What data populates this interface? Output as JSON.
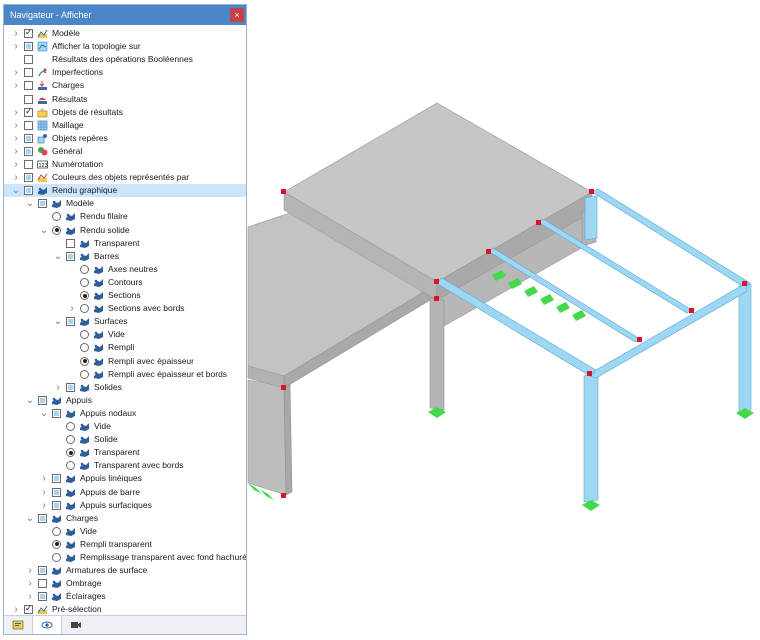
{
  "panel": {
    "title": "Navigateur - Afficher",
    "close_label": "×"
  },
  "tree": [
    {
      "label": "Modèle",
      "level": 0,
      "expander": "collapsed",
      "control": "checkbox",
      "state": "checked",
      "icon": "model-icon"
    },
    {
      "label": "Afficher la topologie sur",
      "level": 0,
      "expander": "collapsed",
      "control": "checkbox",
      "state": "partial",
      "icon": "topology-icon"
    },
    {
      "label": "Résultats des opérations Booléennes",
      "level": 0,
      "expander": "none",
      "control": "checkbox",
      "state": "unchecked",
      "icon": "none"
    },
    {
      "label": "Imperfections",
      "level": 0,
      "expander": "collapsed",
      "control": "checkbox",
      "state": "unchecked",
      "icon": "imperfection-icon"
    },
    {
      "label": "Charges",
      "level": 0,
      "expander": "collapsed",
      "control": "checkbox",
      "state": "unchecked",
      "icon": "load-icon"
    },
    {
      "label": "Résultats",
      "level": 0,
      "expander": "none",
      "control": "checkbox",
      "state": "unchecked",
      "icon": "result-icon"
    },
    {
      "label": "Objets de résultats",
      "level": 0,
      "expander": "collapsed",
      "control": "checkbox",
      "state": "checked",
      "icon": "result-object-icon"
    },
    {
      "label": "Maillage",
      "level": 0,
      "expander": "collapsed",
      "control": "checkbox",
      "state": "unchecked",
      "icon": "mesh-icon"
    },
    {
      "label": "Objets repères",
      "level": 0,
      "expander": "collapsed",
      "control": "checkbox",
      "state": "partial",
      "icon": "guide-object-icon"
    },
    {
      "label": "Général",
      "level": 0,
      "expander": "collapsed",
      "control": "checkbox",
      "state": "partial",
      "icon": "general-icon"
    },
    {
      "label": "Numérotation",
      "level": 0,
      "expander": "collapsed",
      "control": "checkbox",
      "state": "unchecked",
      "icon": "numbering-icon"
    },
    {
      "label": "Couleurs des objets représentés par",
      "level": 0,
      "expander": "collapsed",
      "control": "checkbox",
      "state": "partial",
      "icon": "colors-icon"
    },
    {
      "label": "Rendu graphique",
      "level": 0,
      "expander": "expanded",
      "control": "checkbox",
      "state": "partial",
      "icon": "render-icon",
      "selected": true
    },
    {
      "label": "Modèle",
      "level": 1,
      "expander": "expanded",
      "control": "checkbox",
      "state": "partial",
      "icon": "render-icon"
    },
    {
      "label": "Rendu filaire",
      "level": 2,
      "expander": "none",
      "control": "radio",
      "state": "unchecked",
      "icon": "render-icon"
    },
    {
      "label": "Rendu solide",
      "level": 2,
      "expander": "expanded",
      "control": "radio",
      "state": "checked",
      "icon": "render-icon"
    },
    {
      "label": "Transparent",
      "level": 3,
      "expander": "none",
      "control": "checkbox",
      "state": "unchecked",
      "icon": "render-icon"
    },
    {
      "label": "Barres",
      "level": 3,
      "expander": "expanded",
      "control": "checkbox",
      "state": "partial",
      "icon": "render-icon"
    },
    {
      "label": "Axes neutres",
      "level": 4,
      "expander": "none",
      "control": "radio",
      "state": "unchecked",
      "icon": "render-icon"
    },
    {
      "label": "Contours",
      "level": 4,
      "expander": "none",
      "control": "radio",
      "state": "unchecked",
      "icon": "render-icon"
    },
    {
      "label": "Sections",
      "level": 4,
      "expander": "none",
      "control": "radio",
      "state": "checked",
      "icon": "render-icon"
    },
    {
      "label": "Sections avec bords",
      "level": 4,
      "expander": "collapsed",
      "control": "radio",
      "state": "unchecked",
      "icon": "render-icon"
    },
    {
      "label": "Surfaces",
      "level": 3,
      "expander": "expanded",
      "control": "checkbox",
      "state": "partial",
      "icon": "render-icon"
    },
    {
      "label": "Vide",
      "level": 4,
      "expander": "none",
      "control": "radio",
      "state": "unchecked",
      "icon": "render-icon"
    },
    {
      "label": "Rempli",
      "level": 4,
      "expander": "none",
      "control": "radio",
      "state": "unchecked",
      "icon": "render-icon"
    },
    {
      "label": "Rempli avec épaisseur",
      "level": 4,
      "expander": "none",
      "control": "radio",
      "state": "checked",
      "icon": "render-icon"
    },
    {
      "label": "Rempli avec épaisseur et bords",
      "level": 4,
      "expander": "none",
      "control": "radio",
      "state": "unchecked",
      "icon": "render-icon"
    },
    {
      "label": "Solides",
      "level": 3,
      "expander": "collapsed",
      "control": "checkbox",
      "state": "partial",
      "icon": "render-icon"
    },
    {
      "label": "Appuis",
      "level": 1,
      "expander": "expanded",
      "control": "checkbox",
      "state": "partial",
      "icon": "render-icon"
    },
    {
      "label": "Appuis nodaux",
      "level": 2,
      "expander": "expanded",
      "control": "checkbox",
      "state": "partial",
      "icon": "render-icon"
    },
    {
      "label": "Vide",
      "level": 3,
      "expander": "none",
      "control": "radio",
      "state": "unchecked",
      "icon": "render-icon"
    },
    {
      "label": "Solide",
      "level": 3,
      "expander": "none",
      "control": "radio",
      "state": "unchecked",
      "icon": "render-icon"
    },
    {
      "label": "Transparent",
      "level": 3,
      "expander": "none",
      "control": "radio",
      "state": "checked",
      "icon": "render-icon"
    },
    {
      "label": "Transparent avec bords",
      "level": 3,
      "expander": "none",
      "control": "radio",
      "state": "unchecked",
      "icon": "render-icon"
    },
    {
      "label": "Appuis linéiques",
      "level": 2,
      "expander": "collapsed",
      "control": "checkbox",
      "state": "partial",
      "icon": "render-icon"
    },
    {
      "label": "Appuis de barre",
      "level": 2,
      "expander": "collapsed",
      "control": "checkbox",
      "state": "partial",
      "icon": "render-icon"
    },
    {
      "label": "Appuis surfaciques",
      "level": 2,
      "expander": "collapsed",
      "control": "checkbox",
      "state": "partial",
      "icon": "render-icon"
    },
    {
      "label": "Charges",
      "level": 1,
      "expander": "expanded",
      "control": "checkbox",
      "state": "partial",
      "icon": "render-icon"
    },
    {
      "label": "Vide",
      "level": 2,
      "expander": "none",
      "control": "radio",
      "state": "unchecked",
      "icon": "render-icon"
    },
    {
      "label": "Rempli transparent",
      "level": 2,
      "expander": "none",
      "control": "radio",
      "state": "checked",
      "icon": "render-icon"
    },
    {
      "label": "Remplissage transparent avec fond hachuré",
      "level": 2,
      "expander": "none",
      "control": "radio",
      "state": "unchecked",
      "icon": "render-icon"
    },
    {
      "label": "Armatures de surface",
      "level": 1,
      "expander": "collapsed",
      "control": "checkbox",
      "state": "partial",
      "icon": "render-icon"
    },
    {
      "label": "Ombrage",
      "level": 1,
      "expander": "collapsed",
      "control": "checkbox",
      "state": "unchecked",
      "icon": "render-icon"
    },
    {
      "label": "Éclairages",
      "level": 1,
      "expander": "collapsed",
      "control": "checkbox",
      "state": "partial",
      "icon": "render-icon"
    },
    {
      "label": "Pré-sélection",
      "level": 0,
      "expander": "collapsed",
      "control": "checkbox",
      "state": "checked",
      "icon": "preselection-icon"
    }
  ],
  "bottom_tabs": [
    {
      "name": "data-tab",
      "icon": "data-icon",
      "active": false
    },
    {
      "name": "display-tab",
      "icon": "eye-icon",
      "active": true
    },
    {
      "name": "views-tab",
      "icon": "camera-icon",
      "active": false
    }
  ],
  "colors": {
    "titlebar": "#4a86c8",
    "selection": "#cce5fb",
    "slab_top": "#c4c4c4",
    "member_blue": "#9ed7f3",
    "support_green": "#43d94a",
    "node_red": "#e0102a"
  }
}
